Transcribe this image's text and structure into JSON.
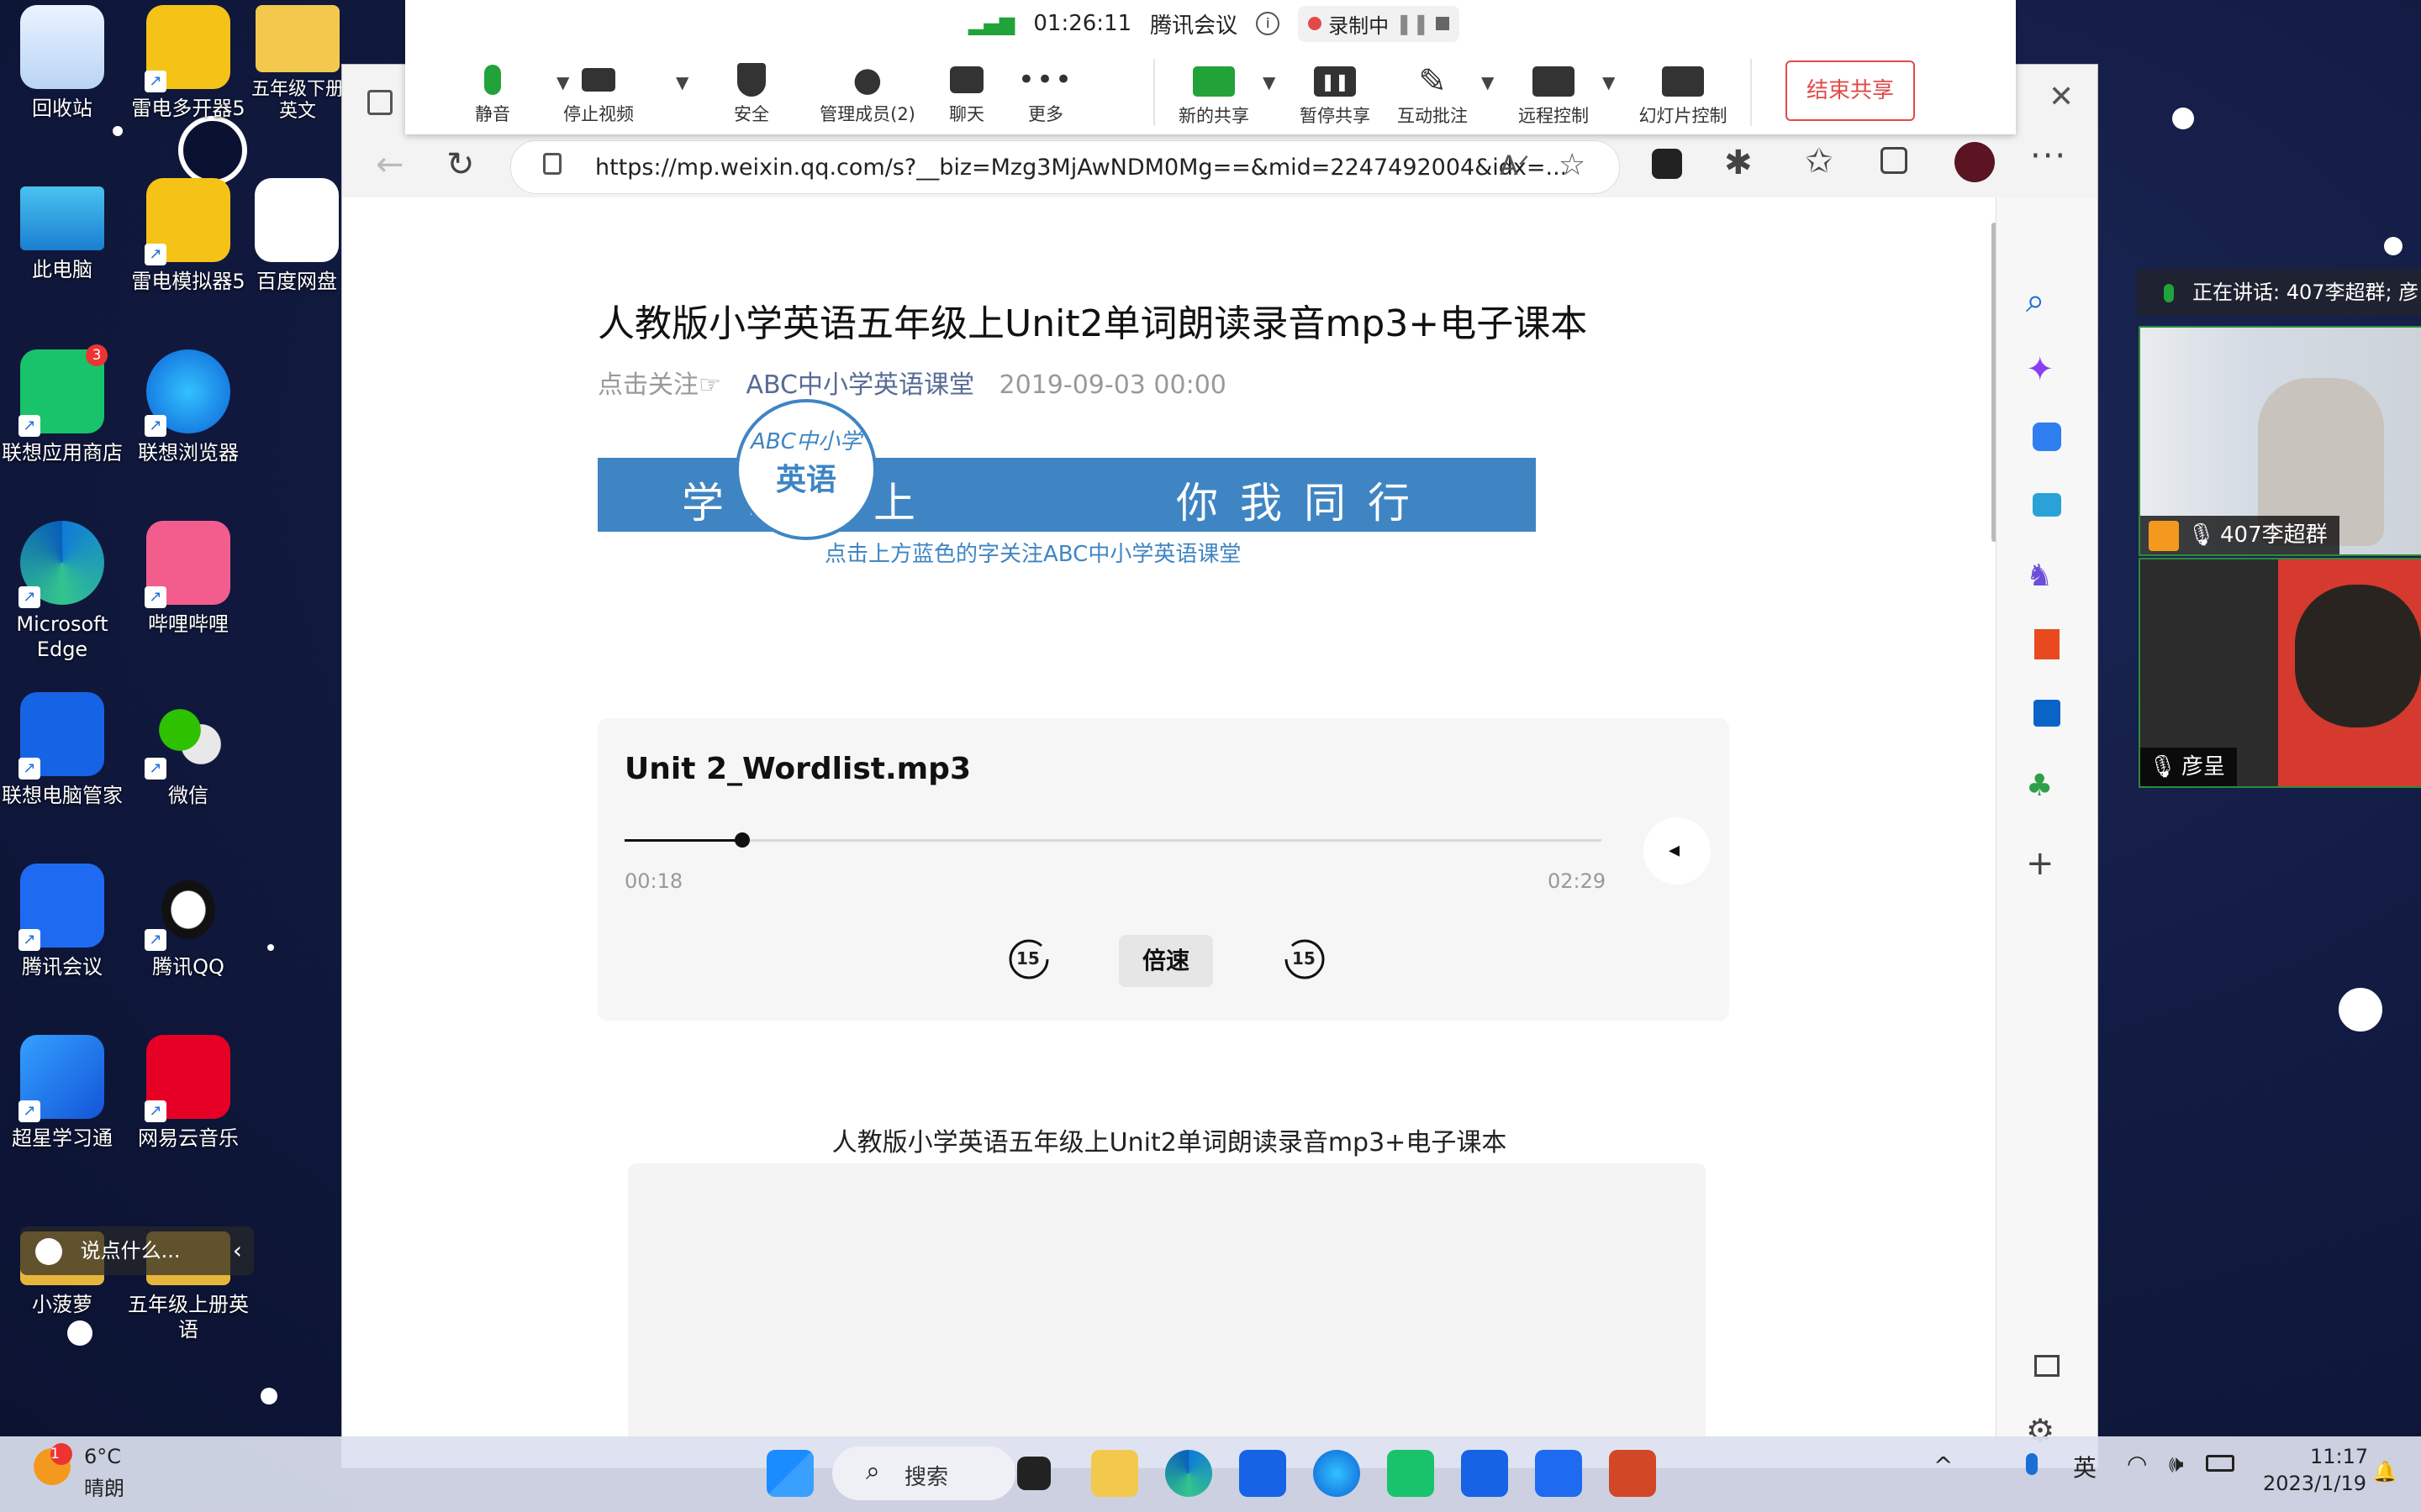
{
  "desktop": {
    "icons": [
      {
        "label": "回收站"
      },
      {
        "label": "雷电多开器5"
      },
      {
        "label": "五年级下册英文"
      },
      {
        "label": "此电脑"
      },
      {
        "label": "雷电模拟器5"
      },
      {
        "label": "百度网盘"
      },
      {
        "label": "联想应用商店",
        "badge": "3"
      },
      {
        "label": "联想浏览器"
      },
      {
        "label": "Microsoft Edge"
      },
      {
        "label": "哔哩哔哩"
      },
      {
        "label": "联想电脑管家"
      },
      {
        "label": "微信"
      },
      {
        "label": "腾讯会议"
      },
      {
        "label": "腾讯QQ"
      },
      {
        "label": "超星学习通"
      },
      {
        "label": "网易云音乐"
      },
      {
        "label": "小菠萝"
      },
      {
        "label": "五年级上册英语"
      }
    ],
    "chat_placeholder": "说点什么..."
  },
  "meeting_toolbar": {
    "timer": "01:26:11",
    "app_name": "腾讯会议",
    "recording": "录制中",
    "buttons": {
      "mute": "静音",
      "stop_video": "停止视频",
      "security": "安全",
      "manage_members": "管理成员(2)",
      "chat": "聊天",
      "more": "更多",
      "new_share": "新的共享",
      "pause_share": "暂停共享",
      "annotate": "互动批注",
      "remote_control": "远程控制",
      "slideshow_control": "幻灯片控制"
    },
    "end_share": "结束共享"
  },
  "browser": {
    "url": "https://mp.weixin.qq.com/s?__biz=Mzg3MjAwNDM0Mg==&mid=2247492004&idx=...",
    "close": "✕"
  },
  "article": {
    "title": "人教版小学英语五年级上Unit2单词朗读录音mp3+电子课本",
    "follow": "点击关注☞",
    "account": "ABC中小学英语课堂",
    "date": "2019-09-03 00:00",
    "banner_left": "学习路上",
    "banner_right": "你我同行",
    "logo_top": "ABC中小学",
    "logo_bottom": "英语",
    "banner_sub": "点击上方蓝色的字关注ABC中小学英语课堂",
    "audio": {
      "title": "Unit 2_Wordlist.mp3",
      "current": "00:18",
      "total": "02:29",
      "progress": 0.1208,
      "rewind": "15",
      "forward": "15",
      "speed": "倍速"
    },
    "caption": "人教版小学英语五年级上Unit2单词朗读录音mp3+电子课本"
  },
  "video_panel": {
    "speaking": "正在讲话: 407李超群; 彦",
    "participants": [
      {
        "name": "407李超群"
      },
      {
        "name": "彦呈"
      }
    ]
  },
  "taskbar": {
    "weather_temp": "6°C",
    "weather_desc": "晴朗",
    "weather_badge": "1",
    "search": "搜索",
    "ime": "英",
    "time": "11:17",
    "date": "2023/1/19"
  },
  "colors": {
    "meeting_green": "#21a33a",
    "end_share_red": "#e24a4a",
    "link_blue": "#576b95",
    "banner_blue": "#3f85c3"
  }
}
